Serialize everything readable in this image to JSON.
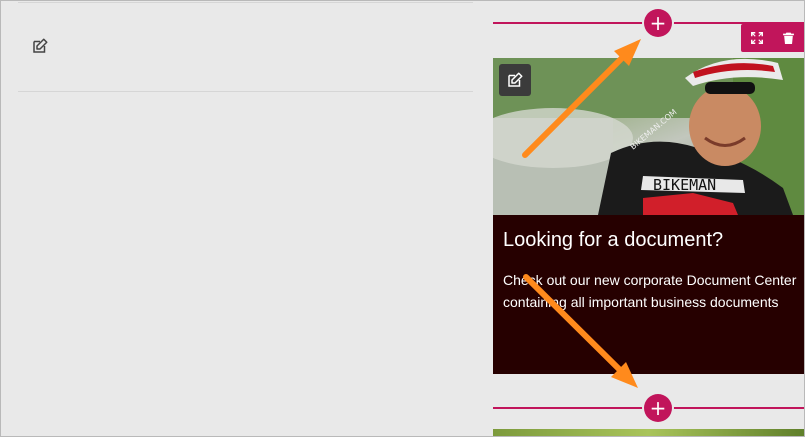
{
  "teaser": {
    "title": "Looking for a document?",
    "text": "Check out our new corporate Document Center containing all important business documents",
    "image_alt": "Cyclist in BIKEMAN team jersey wearing sunglasses"
  },
  "image_labels": {
    "jersey_brand": "BIKEMAN",
    "helmet_text": "BIKEMAN.COM"
  },
  "add_buttons": {
    "top_symbol": "+",
    "bottom_symbol": "+"
  },
  "icons": {
    "left_edit": "edit-icon",
    "image_edit": "edit-icon",
    "fullscreen": "fullscreen-icon",
    "delete": "trash-icon",
    "add": "plus-icon",
    "annotation_arrow": "arrow-icon"
  },
  "colors": {
    "accent": "#c1155b",
    "teaser_background": "#260000",
    "arrow": "#ff8a1c",
    "canvas": "#e9e9e9"
  }
}
